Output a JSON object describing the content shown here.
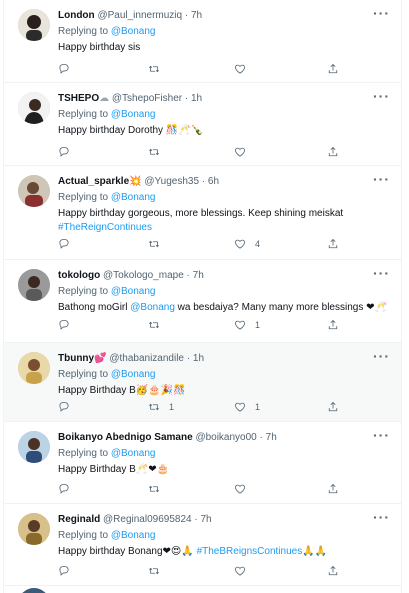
{
  "tweets": [
    {
      "name": "London",
      "name_emoji": "",
      "handle": "@Paul_innermuziq",
      "time": "7h",
      "replying_prefix": "Replying to ",
      "replying_to": "@Bonang",
      "text_parts": [
        {
          "t": "Happy birthday sis",
          "k": "text"
        }
      ],
      "reply_count": "",
      "retweet_count": "",
      "like_count": ""
    },
    {
      "name": "TSHEPO",
      "name_emoji": "☁",
      "handle": "@TshepoFisher",
      "time": "1h",
      "replying_prefix": "Replying to ",
      "replying_to": "@Bonang",
      "text_parts": [
        {
          "t": "Happy birthday Dorothy ",
          "k": "text"
        },
        {
          "t": "🎊🥂🍾",
          "k": "emoji"
        }
      ],
      "reply_count": "",
      "retweet_count": "",
      "like_count": ""
    },
    {
      "name": "Actual_sparkle",
      "name_emoji": "💥",
      "handle": "@Yugesh35",
      "time": "6h",
      "replying_prefix": "Replying to ",
      "replying_to": "@Bonang",
      "text_parts": [
        {
          "t": "Happy birthday gorgeous, more blessings. Keep shining meiskat",
          "k": "text"
        },
        {
          "t": "\n",
          "k": "br"
        },
        {
          "t": "#TheReignContinues",
          "k": "hashtag"
        }
      ],
      "reply_count": "",
      "retweet_count": "",
      "like_count": "4"
    },
    {
      "name": "tokologo",
      "name_emoji": "",
      "handle": "@Tokologo_mape",
      "time": "7h",
      "replying_prefix": "Replying to ",
      "replying_to": "@Bonang",
      "text_parts": [
        {
          "t": "Bathong moGirl  ",
          "k": "text"
        },
        {
          "t": "@Bonang",
          "k": "mention"
        },
        {
          "t": " wa besdaiya? Many many more blessings ",
          "k": "text"
        },
        {
          "t": "❤🥂",
          "k": "emoji"
        }
      ],
      "reply_count": "",
      "retweet_count": "",
      "like_count": "1"
    },
    {
      "name": "Tbunny",
      "name_emoji": "💕",
      "handle": "@thabanizandile",
      "time": "1h",
      "replying_prefix": "Replying to ",
      "replying_to": "@Bonang",
      "text_parts": [
        {
          "t": "Happy Birthday B",
          "k": "text"
        },
        {
          "t": "🥳🎂🎉🎊",
          "k": "emoji"
        }
      ],
      "reply_count": "",
      "retweet_count": "1",
      "like_count": "1"
    },
    {
      "name": "Boikanyo Abednigo Samane",
      "name_emoji": "",
      "handle": "@boikanyo00",
      "time": "7h",
      "replying_prefix": "Replying to ",
      "replying_to": "@Bonang",
      "text_parts": [
        {
          "t": "Happy Birthday B",
          "k": "text"
        },
        {
          "t": "🥂❤🎂",
          "k": "emoji"
        }
      ],
      "reply_count": "",
      "retweet_count": "",
      "like_count": ""
    },
    {
      "name": "Reginald",
      "name_emoji": "",
      "handle": "@Reginal09695824",
      "time": "7h",
      "replying_prefix": "Replying to ",
      "replying_to": "@Bonang",
      "text_parts": [
        {
          "t": "Happy birthday Bonang",
          "k": "text"
        },
        {
          "t": "❤😍🙏",
          "k": "emoji"
        },
        {
          "t": " #TheBReignsContinues",
          "k": "hashtag"
        },
        {
          "t": "🙏🙏",
          "k": "emoji"
        }
      ],
      "reply_count": "",
      "retweet_count": "",
      "like_count": ""
    }
  ],
  "dot_separator": " · ",
  "more_icon": "more-horizontal-icon",
  "icons": [
    "reply-icon",
    "retweet-icon",
    "like-icon",
    "share-icon"
  ],
  "colors": {
    "link": "#1d9bf0",
    "muted": "#536471",
    "text": "#0f1419",
    "highlight_bg": "#f7f9f9",
    "divider": "#eff3f4"
  }
}
